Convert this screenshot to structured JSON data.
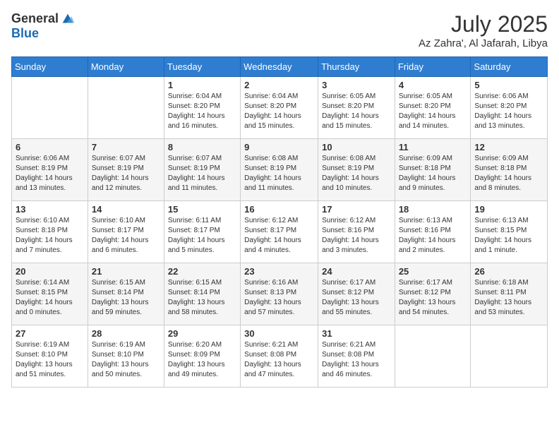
{
  "logo": {
    "general": "General",
    "blue": "Blue"
  },
  "title": {
    "month_year": "July 2025",
    "location": "Az Zahra', Al Jafarah, Libya"
  },
  "weekdays": [
    "Sunday",
    "Monday",
    "Tuesday",
    "Wednesday",
    "Thursday",
    "Friday",
    "Saturday"
  ],
  "weeks": [
    [
      {
        "day": "",
        "detail": ""
      },
      {
        "day": "",
        "detail": ""
      },
      {
        "day": "1",
        "detail": "Sunrise: 6:04 AM\nSunset: 8:20 PM\nDaylight: 14 hours and 16 minutes."
      },
      {
        "day": "2",
        "detail": "Sunrise: 6:04 AM\nSunset: 8:20 PM\nDaylight: 14 hours and 15 minutes."
      },
      {
        "day": "3",
        "detail": "Sunrise: 6:05 AM\nSunset: 8:20 PM\nDaylight: 14 hours and 15 minutes."
      },
      {
        "day": "4",
        "detail": "Sunrise: 6:05 AM\nSunset: 8:20 PM\nDaylight: 14 hours and 14 minutes."
      },
      {
        "day": "5",
        "detail": "Sunrise: 6:06 AM\nSunset: 8:20 PM\nDaylight: 14 hours and 13 minutes."
      }
    ],
    [
      {
        "day": "6",
        "detail": "Sunrise: 6:06 AM\nSunset: 8:19 PM\nDaylight: 14 hours and 13 minutes."
      },
      {
        "day": "7",
        "detail": "Sunrise: 6:07 AM\nSunset: 8:19 PM\nDaylight: 14 hours and 12 minutes."
      },
      {
        "day": "8",
        "detail": "Sunrise: 6:07 AM\nSunset: 8:19 PM\nDaylight: 14 hours and 11 minutes."
      },
      {
        "day": "9",
        "detail": "Sunrise: 6:08 AM\nSunset: 8:19 PM\nDaylight: 14 hours and 11 minutes."
      },
      {
        "day": "10",
        "detail": "Sunrise: 6:08 AM\nSunset: 8:19 PM\nDaylight: 14 hours and 10 minutes."
      },
      {
        "day": "11",
        "detail": "Sunrise: 6:09 AM\nSunset: 8:18 PM\nDaylight: 14 hours and 9 minutes."
      },
      {
        "day": "12",
        "detail": "Sunrise: 6:09 AM\nSunset: 8:18 PM\nDaylight: 14 hours and 8 minutes."
      }
    ],
    [
      {
        "day": "13",
        "detail": "Sunrise: 6:10 AM\nSunset: 8:18 PM\nDaylight: 14 hours and 7 minutes."
      },
      {
        "day": "14",
        "detail": "Sunrise: 6:10 AM\nSunset: 8:17 PM\nDaylight: 14 hours and 6 minutes."
      },
      {
        "day": "15",
        "detail": "Sunrise: 6:11 AM\nSunset: 8:17 PM\nDaylight: 14 hours and 5 minutes."
      },
      {
        "day": "16",
        "detail": "Sunrise: 6:12 AM\nSunset: 8:17 PM\nDaylight: 14 hours and 4 minutes."
      },
      {
        "day": "17",
        "detail": "Sunrise: 6:12 AM\nSunset: 8:16 PM\nDaylight: 14 hours and 3 minutes."
      },
      {
        "day": "18",
        "detail": "Sunrise: 6:13 AM\nSunset: 8:16 PM\nDaylight: 14 hours and 2 minutes."
      },
      {
        "day": "19",
        "detail": "Sunrise: 6:13 AM\nSunset: 8:15 PM\nDaylight: 14 hours and 1 minute."
      }
    ],
    [
      {
        "day": "20",
        "detail": "Sunrise: 6:14 AM\nSunset: 8:15 PM\nDaylight: 14 hours and 0 minutes."
      },
      {
        "day": "21",
        "detail": "Sunrise: 6:15 AM\nSunset: 8:14 PM\nDaylight: 13 hours and 59 minutes."
      },
      {
        "day": "22",
        "detail": "Sunrise: 6:15 AM\nSunset: 8:14 PM\nDaylight: 13 hours and 58 minutes."
      },
      {
        "day": "23",
        "detail": "Sunrise: 6:16 AM\nSunset: 8:13 PM\nDaylight: 13 hours and 57 minutes."
      },
      {
        "day": "24",
        "detail": "Sunrise: 6:17 AM\nSunset: 8:12 PM\nDaylight: 13 hours and 55 minutes."
      },
      {
        "day": "25",
        "detail": "Sunrise: 6:17 AM\nSunset: 8:12 PM\nDaylight: 13 hours and 54 minutes."
      },
      {
        "day": "26",
        "detail": "Sunrise: 6:18 AM\nSunset: 8:11 PM\nDaylight: 13 hours and 53 minutes."
      }
    ],
    [
      {
        "day": "27",
        "detail": "Sunrise: 6:19 AM\nSunset: 8:10 PM\nDaylight: 13 hours and 51 minutes."
      },
      {
        "day": "28",
        "detail": "Sunrise: 6:19 AM\nSunset: 8:10 PM\nDaylight: 13 hours and 50 minutes."
      },
      {
        "day": "29",
        "detail": "Sunrise: 6:20 AM\nSunset: 8:09 PM\nDaylight: 13 hours and 49 minutes."
      },
      {
        "day": "30",
        "detail": "Sunrise: 6:21 AM\nSunset: 8:08 PM\nDaylight: 13 hours and 47 minutes."
      },
      {
        "day": "31",
        "detail": "Sunrise: 6:21 AM\nSunset: 8:08 PM\nDaylight: 13 hours and 46 minutes."
      },
      {
        "day": "",
        "detail": ""
      },
      {
        "day": "",
        "detail": ""
      }
    ]
  ]
}
